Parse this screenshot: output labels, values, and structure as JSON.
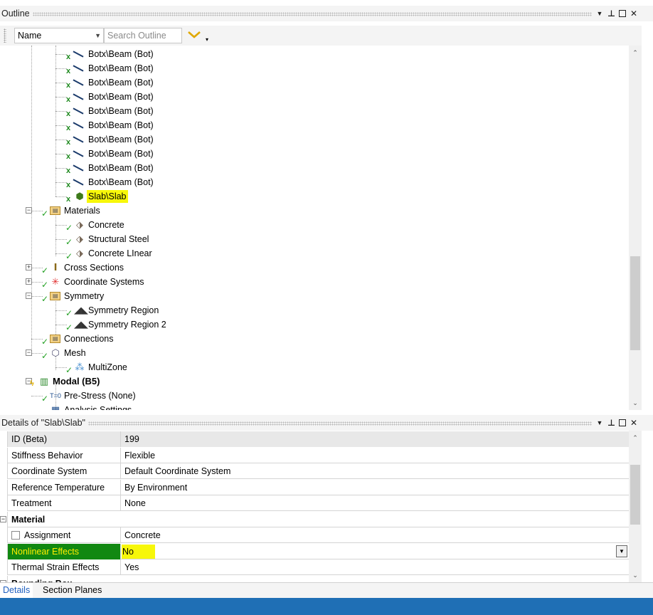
{
  "outline": {
    "title": "Outline",
    "controls": {
      "dropdown": "▼",
      "pin": "ᵽ",
      "close": "✕"
    },
    "toolbar": {
      "name_select": "Name",
      "search_placeholder": "Search Outline"
    },
    "tree": [
      {
        "label": "Botx\\Beam (Bot)",
        "icon": "beam-icon",
        "status": "x",
        "level": 3
      },
      {
        "label": "Botx\\Beam (Bot)",
        "icon": "beam-icon",
        "status": "x",
        "level": 3
      },
      {
        "label": "Botx\\Beam (Bot)",
        "icon": "beam-icon",
        "status": "x",
        "level": 3
      },
      {
        "label": "Botx\\Beam (Bot)",
        "icon": "beam-icon",
        "status": "x",
        "level": 3
      },
      {
        "label": "Botx\\Beam (Bot)",
        "icon": "beam-icon",
        "status": "x",
        "level": 3
      },
      {
        "label": "Botx\\Beam (Bot)",
        "icon": "beam-icon",
        "status": "x",
        "level": 3
      },
      {
        "label": "Botx\\Beam (Bot)",
        "icon": "beam-icon",
        "status": "x",
        "level": 3
      },
      {
        "label": "Botx\\Beam (Bot)",
        "icon": "beam-icon",
        "status": "x",
        "level": 3
      },
      {
        "label": "Botx\\Beam (Bot)",
        "icon": "beam-icon",
        "status": "x",
        "level": 3
      },
      {
        "label": "Botx\\Beam (Bot)",
        "icon": "beam-icon",
        "status": "x",
        "level": 3
      },
      {
        "label": "Slab\\Slab",
        "icon": "solid-body-icon",
        "status": "x",
        "level": 3,
        "highlight": true
      },
      {
        "label": "Materials",
        "icon": "materials-folder-icon",
        "status": "check",
        "level": 2,
        "expander": "−"
      },
      {
        "label": "Concrete",
        "icon": "material-tag-icon",
        "status": "check",
        "level": 3
      },
      {
        "label": "Structural Steel",
        "icon": "material-tag-icon",
        "status": "check",
        "level": 3
      },
      {
        "label": "Concrete LInear",
        "icon": "material-tag-icon",
        "status": "check",
        "level": 3
      },
      {
        "label": "Cross Sections",
        "icon": "cross-section-icon",
        "status": "check",
        "level": 2,
        "expander": "+"
      },
      {
        "label": "Coordinate Systems",
        "icon": "coordinate-systems-icon",
        "status": "check",
        "level": 2,
        "expander": "+"
      },
      {
        "label": "Symmetry",
        "icon": "symmetry-folder-icon",
        "status": "check",
        "level": 2,
        "expander": "−"
      },
      {
        "label": "Symmetry Region",
        "icon": "symmetry-region-icon",
        "status": "check",
        "level": 3
      },
      {
        "label": "Symmetry Region 2",
        "icon": "symmetry-region-icon",
        "status": "check",
        "level": 3
      },
      {
        "label": "Connections",
        "icon": "connections-folder-icon",
        "status": "check",
        "level": 2
      },
      {
        "label": "Mesh",
        "icon": "mesh-icon",
        "status": "check",
        "level": 2,
        "expander": "−"
      },
      {
        "label": "MultiZone",
        "icon": "multizone-icon",
        "status": "check",
        "level": 3
      },
      {
        "label": "Modal (B5)",
        "icon": "modal-analysis-icon",
        "status": "bolt",
        "level": 1,
        "expander": "−",
        "bold": true
      },
      {
        "label": "Pre-Stress (None)",
        "icon": "pre-stress-icon",
        "status": "check",
        "level": 2
      },
      {
        "label": "Analysis Settings",
        "icon": "analysis-settings-icon",
        "status": "check",
        "level": 2
      }
    ]
  },
  "details": {
    "title": "Details of \"Slab\\Slab\"",
    "rows": [
      {
        "name": "ID (Beta)",
        "value": "199",
        "style": "gray"
      },
      {
        "name": "Stiffness Behavior",
        "value": "Flexible"
      },
      {
        "name": "Coordinate System",
        "value": "Default Coordinate System"
      },
      {
        "name": "Reference Temperature",
        "value": "By Environment"
      },
      {
        "name": "Treatment",
        "value": "None"
      },
      {
        "name": "Material",
        "value": "",
        "style": "group"
      },
      {
        "name": "Assignment",
        "value": "Concrete",
        "checkbox": true
      },
      {
        "name": "Nonlinear Effects",
        "value": "No",
        "style": "selected"
      },
      {
        "name": "Thermal Strain Effects",
        "value": "Yes"
      },
      {
        "name": "Bounding Box",
        "value": "",
        "style": "group"
      }
    ]
  },
  "tabs": [
    {
      "label": "Details",
      "active": true
    },
    {
      "label": "Section Planes",
      "active": false
    }
  ],
  "colors": {
    "accent_blue": "#1f6fb5",
    "highlight_yellow": "#f7f70a",
    "selected_green": "#118811",
    "check_green": "#22a022"
  }
}
